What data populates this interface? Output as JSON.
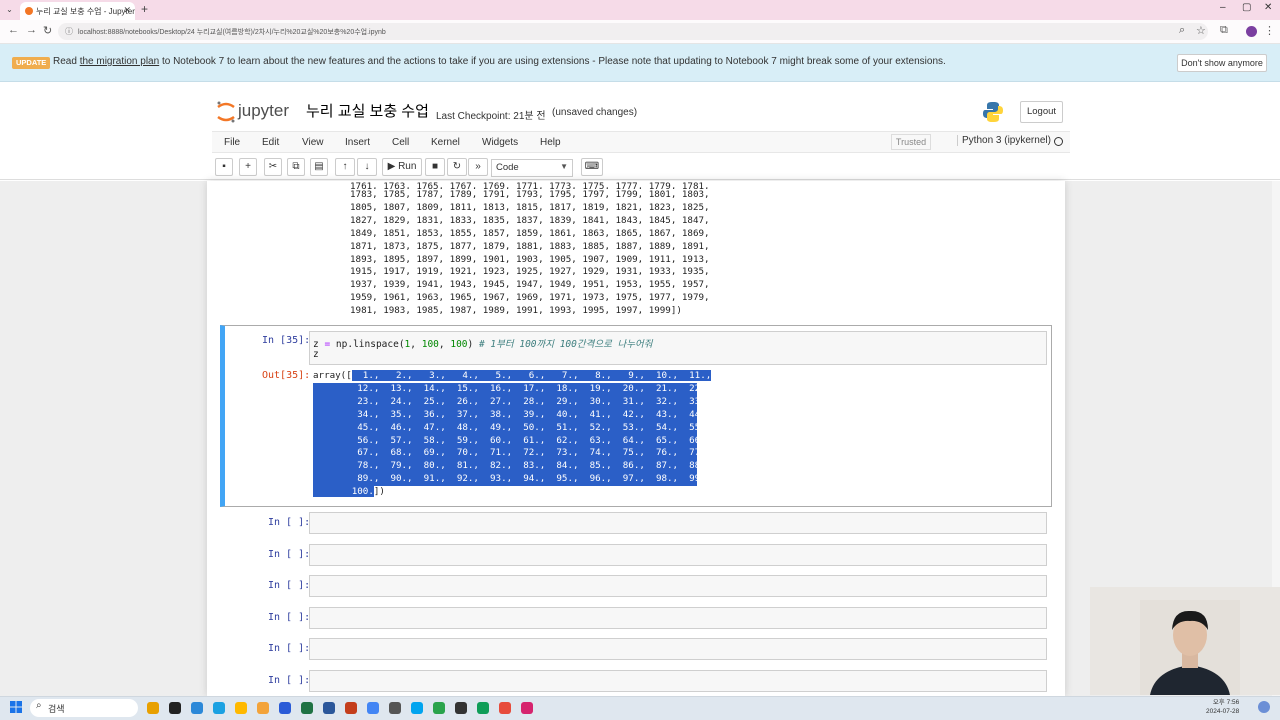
{
  "browser": {
    "tab_title": "누리 교실 보충 수업 - Jupyter",
    "tab_close": "✕",
    "new_tab": "+",
    "url": "localhost:8888/notebooks/Desktop/24 누리교실(여름방학)/2차시/누리%20교실%20보충%20수업.ipynb",
    "win_min": "–",
    "win_max": "▢",
    "win_close": "✕"
  },
  "banner": {
    "badge": "UPDATE",
    "text_before": "Read ",
    "link": "the migration plan",
    "text_after": " to Notebook 7 to learn about the new features and the actions to take if you are using extensions - Please note that updating to Notebook 7 might break some of your extensions.",
    "dismiss": "Don't show anymore"
  },
  "header": {
    "logo_text": "jupyter",
    "notebook_title": "누리 교실 보충 수업",
    "checkpoint": "Last Checkpoint: 21분 전",
    "unsaved": "(unsaved changes)",
    "logout": "Logout"
  },
  "menubar": {
    "items": [
      "File",
      "Edit",
      "View",
      "Insert",
      "Cell",
      "Kernel",
      "Widgets",
      "Help"
    ],
    "trusted": "Trusted",
    "kernel": "Python 3 (ipykernel)"
  },
  "toolbar": {
    "run": "Run",
    "cell_type": "Code"
  },
  "prev_output": {
    "lines": [
      "1761, 1763, 1765, 1767, 1769, 1771, 1773, 1775, 1777, 1779, 1781,",
      "1783, 1785, 1787, 1789, 1791, 1793, 1795, 1797, 1799, 1801, 1803,",
      "1805, 1807, 1809, 1811, 1813, 1815, 1817, 1819, 1821, 1823, 1825,",
      "1827, 1829, 1831, 1833, 1835, 1837, 1839, 1841, 1843, 1845, 1847,",
      "1849, 1851, 1853, 1855, 1857, 1859, 1861, 1863, 1865, 1867, 1869,",
      "1871, 1873, 1875, 1877, 1879, 1881, 1883, 1885, 1887, 1889, 1891,",
      "1893, 1895, 1897, 1899, 1901, 1903, 1905, 1907, 1909, 1911, 1913,",
      "1915, 1917, 1919, 1921, 1923, 1925, 1927, 1929, 1931, 1933, 1935,",
      "1937, 1939, 1941, 1943, 1945, 1947, 1949, 1951, 1953, 1955, 1957,",
      "1959, 1961, 1963, 1965, 1967, 1969, 1971, 1973, 1975, 1977, 1979,",
      "1981, 1983, 1985, 1987, 1989, 1991, 1993, 1995, 1997, 1999])"
    ]
  },
  "cell35": {
    "in_prompt": "In [35]:",
    "code_var": "z",
    "code_eq": " = ",
    "code_call": "np.linspace(",
    "code_args_1": "1",
    "code_args_2": "100",
    "code_args_3": "100",
    "code_close": ")",
    "code_comment": " # 1부터 100까지 100간격으로 나누어줘",
    "code_line2": "z",
    "out_prompt": "Out[35]:",
    "output_lines": [
      "array([  1.,   2.,   3.,   4.,   5.,   6.,   7.,   8.,   9.,  10.,  11.,",
      "        12.,  13.,  14.,  15.,  16.,  17.,  18.,  19.,  20.,  21.,  22.,",
      "        23.,  24.,  25.,  26.,  27.,  28.,  29.,  30.,  31.,  32.,  33.,",
      "        34.,  35.,  36.,  37.,  38.,  39.,  40.,  41.,  42.,  43.,  44.,",
      "        45.,  46.,  47.,  48.,  49.,  50.,  51.,  52.,  53.,  54.,  55.,",
      "        56.,  57.,  58.,  59.,  60.,  61.,  62.,  63.,  64.,  65.,  66.,",
      "        67.,  68.,  69.,  70.,  71.,  72.,  73.,  74.,  75.,  76.,  77.,",
      "        78.,  79.,  80.,  81.,  82.,  83.,  84.,  85.,  86.,  87.,  88.,",
      "        89.,  90.,  91.,  92.,  93.,  94.,  95.,  96.,  97.,  98.,  99.,",
      "       100.])"
    ]
  },
  "empty_cells": {
    "prompt": "In [ ]:",
    "count": 6
  },
  "taskbar": {
    "search": "검색",
    "time_line1": "오후 7:56",
    "time_line2": "2024-07-28"
  },
  "colors": {
    "accent_blue": "#42a5f5",
    "selection": "#2b5fc7",
    "banner_bg": "#d8eef7",
    "update_badge": "#f0ad4e"
  }
}
